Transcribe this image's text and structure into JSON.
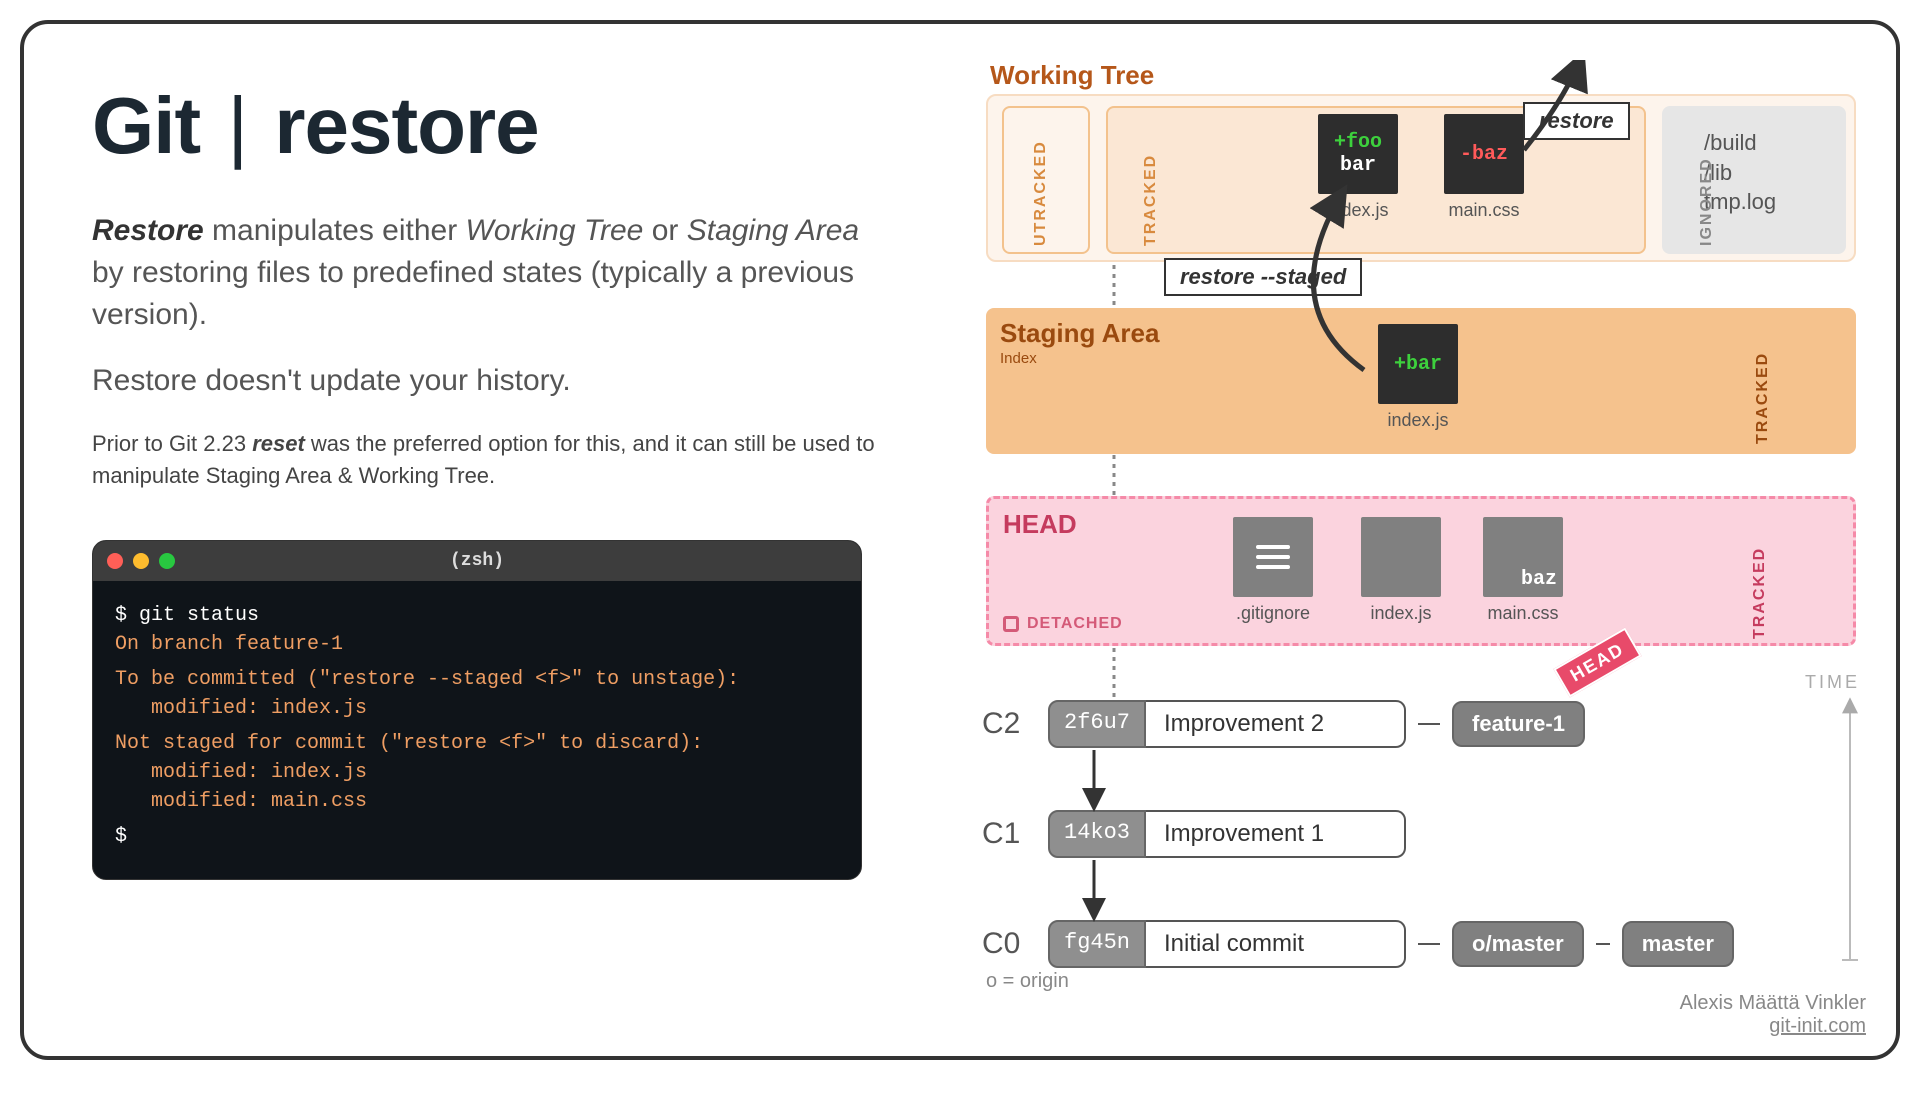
{
  "title": {
    "prefix": "Git",
    "pipe": "|",
    "suffix": "restore"
  },
  "intro": {
    "lead": "Restore",
    "t1": " manipulates either ",
    "em1": "Working Tree",
    "t2": " or ",
    "em2": "Staging Area",
    "t3": " by restoring files to predefined states (typically a previous version)."
  },
  "p2": "Restore doesn't update your history.",
  "note": {
    "t1": "Prior to Git 2.23 ",
    "b": "reset",
    "t2": " was the preferred option for this, and it can still be used to manipulate Staging Area & Working Tree."
  },
  "terminal": {
    "title": "(zsh)",
    "cmd": "$ git status",
    "l1": "On branch feature-1",
    "l2": "To be committed (\"restore --staged <f>\" to unstage):",
    "l3": "modified: index.js",
    "l4": "Not staged for commit (\"restore <f>\" to discard):",
    "l5": "modified: index.js",
    "l6": "modified: main.css",
    "prompt": "$"
  },
  "wt": {
    "label": "Working Tree",
    "utracked": "UTRACKED",
    "tracked": "TRACKED",
    "ignored_label": "IGNORED",
    "ignored": [
      "/build",
      "/lib",
      "tmp.log"
    ],
    "file1": {
      "line1": "+foo",
      "line2": "bar",
      "name": "index.js"
    },
    "file2": {
      "line1": "-baz",
      "name": "main.css"
    }
  },
  "restore_tag": "restore",
  "restore_staged_tag": "restore --staged",
  "sa": {
    "label": "Staging Area",
    "sub": "Index",
    "tracked": "TRACKED",
    "file": {
      "line1": "+bar",
      "name": "index.js"
    }
  },
  "head": {
    "label": "HEAD",
    "detached": "DETACHED",
    "tracked": "TRACKED",
    "files": [
      {
        "name": ".gitignore",
        "kind": "hamburger"
      },
      {
        "name": "index.js",
        "kind": "blank"
      },
      {
        "name": "main.css",
        "kind": "baz"
      }
    ],
    "baz": "baz",
    "pointer": "HEAD"
  },
  "commits": [
    {
      "id": "C2",
      "hash": "2f6u7",
      "msg": "Improvement 2",
      "branches": [
        "feature-1"
      ]
    },
    {
      "id": "C1",
      "hash": "14ko3",
      "msg": "Improvement 1",
      "branches": []
    },
    {
      "id": "C0",
      "hash": "fg45n",
      "msg": "Initial commit",
      "branches": [
        "o/master",
        "master"
      ]
    }
  ],
  "time_label": "TIME",
  "origin_note": "o = origin",
  "credit": {
    "name": "Alexis Määttä Vinkler",
    "link": "git-init.com"
  }
}
